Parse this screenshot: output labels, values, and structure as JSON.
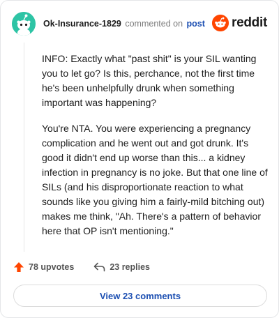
{
  "header": {
    "username": "Ok-Insurance-1829",
    "meta": "commented on",
    "post_link": "post",
    "logo_text": "reddit"
  },
  "comment": {
    "paragraphs": [
      "INFO: Exactly what \"past shit\" is your SIL wanting you to let go? Is this, perchance, not the first time he's been unhelpfully drunk when something important was happening?",
      "You're NTA. You were experiencing a pregnancy complication and he went out and got drunk. It's good it didn't end up worse than this... a kidney infection in pregnancy is no joke. But that one line of SILs (and his disproportionate reaction to what sounds like you giving him a fairly-mild bitching out) makes me think, \"Ah. There's a pattern of behavior here that OP isn't mentioning.\""
    ]
  },
  "actions": {
    "upvotes": "78 upvotes",
    "replies": "23 replies"
  },
  "footer": {
    "view_comments": "View 23 comments"
  },
  "colors": {
    "accent": "#ff4500",
    "link": "#1c4fb2",
    "avatar_bg": "#2ec4a5"
  },
  "icons": {
    "avatar": "snoo-avatar-icon",
    "logo": "reddit-logo-icon",
    "upvote": "upvote-arrow-icon",
    "reply": "reply-arrow-icon"
  }
}
